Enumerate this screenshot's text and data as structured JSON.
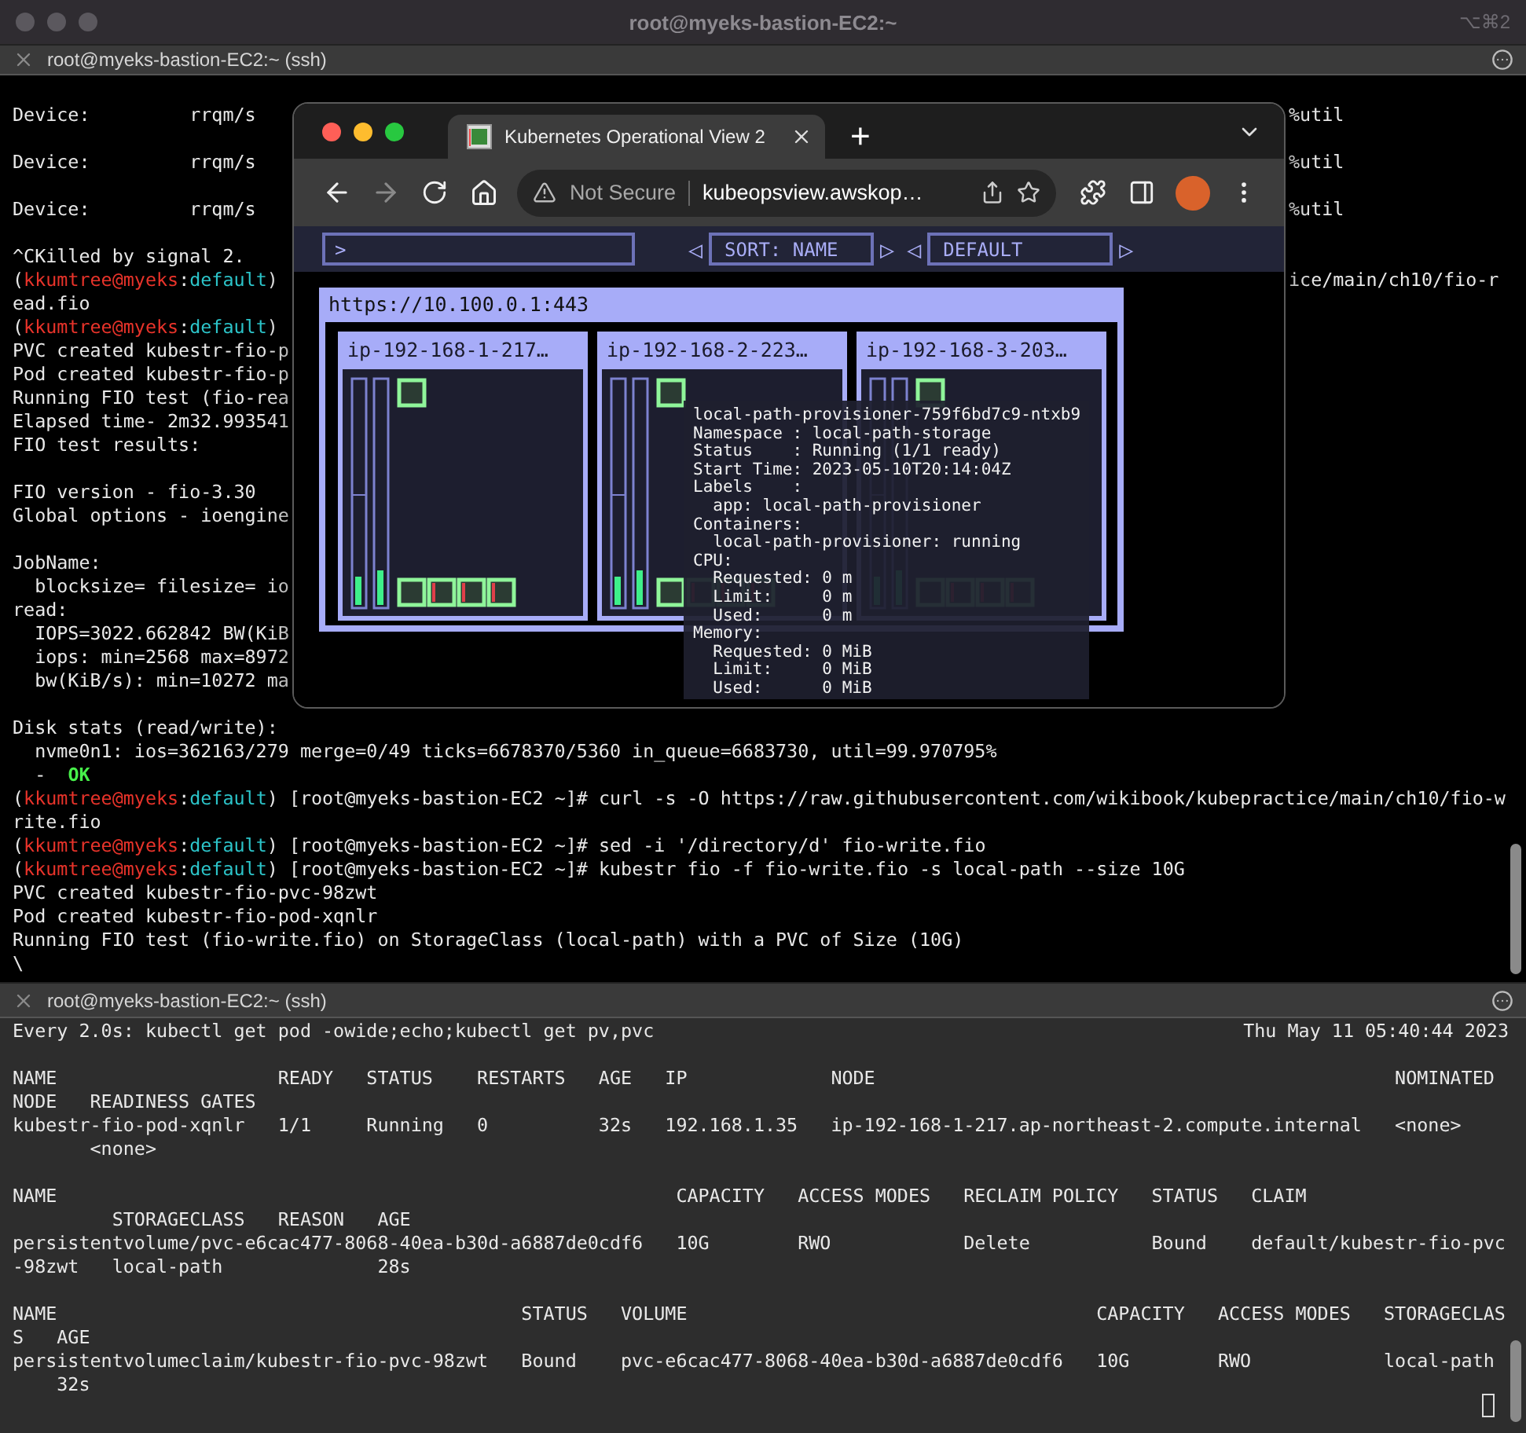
{
  "window": {
    "title": "root@myeks-bastion-EC2:~",
    "shortcut": "⌥⌘2"
  },
  "top_pane": {
    "tab_title": "root@myeks-bastion-EC2:~ (ssh)",
    "lines": [
      {
        "kind": "text",
        "parts": [
          {
            "text": "Device:         rrqm/s",
            "kind": "plain"
          }
        ],
        "right": "%util"
      },
      {
        "kind": "blank"
      },
      {
        "kind": "text",
        "parts": [
          {
            "text": "Device:         rrqm/s",
            "kind": "plain"
          }
        ],
        "right": "%util"
      },
      {
        "kind": "blank"
      },
      {
        "kind": "text",
        "parts": [
          {
            "text": "Device:         rrqm/s",
            "kind": "plain"
          }
        ],
        "right": "%util"
      },
      {
        "kind": "blank"
      },
      {
        "kind": "text",
        "parts": [
          {
            "text": "^CKilled by signal 2.",
            "kind": "plain"
          }
        ]
      },
      {
        "kind": "text",
        "parts": [
          {
            "text": "(",
            "kind": "plain"
          },
          {
            "text": "kkumtree@myeks",
            "kind": "user"
          },
          {
            "text": ":",
            "kind": "plain"
          },
          {
            "text": "default",
            "kind": "ns"
          },
          {
            "text": ")",
            "kind": "plain"
          }
        ],
        "right": "ice/main/ch10/fio-r"
      },
      {
        "kind": "text",
        "parts": [
          {
            "text": "ead.fio",
            "kind": "plain"
          }
        ]
      },
      {
        "kind": "text",
        "parts": [
          {
            "text": "(",
            "kind": "plain"
          },
          {
            "text": "kkumtree@myeks",
            "kind": "user"
          },
          {
            "text": ":",
            "kind": "plain"
          },
          {
            "text": "default",
            "kind": "ns"
          },
          {
            "text": ")",
            "kind": "plain"
          }
        ]
      },
      {
        "kind": "text",
        "parts": [
          {
            "text": "PVC created kubestr-fio-p",
            "kind": "plain"
          }
        ]
      },
      {
        "kind": "text",
        "parts": [
          {
            "text": "Pod created kubestr-fio-p",
            "kind": "plain"
          }
        ]
      },
      {
        "kind": "text",
        "parts": [
          {
            "text": "Running FIO test (fio-rea",
            "kind": "plain"
          }
        ]
      },
      {
        "kind": "text",
        "parts": [
          {
            "text": "Elapsed time- 2m32.993541",
            "kind": "plain"
          }
        ]
      },
      {
        "kind": "text",
        "parts": [
          {
            "text": "FIO test results:",
            "kind": "plain"
          }
        ]
      },
      {
        "kind": "blank"
      },
      {
        "kind": "text",
        "parts": [
          {
            "text": "FIO version - fio-3.30",
            "kind": "plain"
          }
        ]
      },
      {
        "kind": "text",
        "parts": [
          {
            "text": "Global options - ioengine",
            "kind": "plain"
          }
        ]
      },
      {
        "kind": "blank"
      },
      {
        "kind": "text",
        "parts": [
          {
            "text": "JobName:",
            "kind": "plain"
          }
        ]
      },
      {
        "kind": "text",
        "parts": [
          {
            "text": "  blocksize= filesize= io",
            "kind": "plain"
          }
        ]
      },
      {
        "kind": "text",
        "parts": [
          {
            "text": "read:",
            "kind": "plain"
          }
        ]
      },
      {
        "kind": "text",
        "parts": [
          {
            "text": "  IOPS=3022.662842 BW(KiB",
            "kind": "plain"
          }
        ]
      },
      {
        "kind": "text",
        "parts": [
          {
            "text": "  iops: min=2568 max=8972",
            "kind": "plain"
          }
        ]
      },
      {
        "kind": "text",
        "parts": [
          {
            "text": "  bw(KiB/s): min=10272 ma",
            "kind": "plain"
          }
        ]
      },
      {
        "kind": "blank"
      },
      {
        "kind": "text",
        "parts": [
          {
            "text": "Disk stats (read/write):",
            "kind": "plain"
          }
        ]
      },
      {
        "kind": "text",
        "parts": [
          {
            "text": "  nvme0n1: ios=362163/279 merge=0/49 ticks=6678370/5360 in_queue=6683730, util=99.970795%",
            "kind": "plain"
          }
        ]
      },
      {
        "kind": "text",
        "parts": [
          {
            "text": "  -  ",
            "kind": "plain"
          },
          {
            "text": "OK",
            "kind": "ok"
          }
        ]
      },
      {
        "kind": "text",
        "parts": [
          {
            "text": "(",
            "kind": "plain"
          },
          {
            "text": "kkumtree@myeks",
            "kind": "user"
          },
          {
            "text": ":",
            "kind": "plain"
          },
          {
            "text": "default",
            "kind": "ns"
          },
          {
            "text": ") [root@myeks-bastion-EC2 ~]# curl -s -O https://raw.githubusercontent.com/wikibook/kubepractice/main/ch10/fio-w",
            "kind": "plain"
          }
        ]
      },
      {
        "kind": "text",
        "parts": [
          {
            "text": "rite.fio",
            "kind": "plain"
          }
        ]
      },
      {
        "kind": "text",
        "parts": [
          {
            "text": "(",
            "kind": "plain"
          },
          {
            "text": "kkumtree@myeks",
            "kind": "user"
          },
          {
            "text": ":",
            "kind": "plain"
          },
          {
            "text": "default",
            "kind": "ns"
          },
          {
            "text": ") [root@myeks-bastion-EC2 ~]# sed -i '/directory/d' fio-write.fio",
            "kind": "plain"
          }
        ]
      },
      {
        "kind": "text",
        "parts": [
          {
            "text": "(",
            "kind": "plain"
          },
          {
            "text": "kkumtree@myeks",
            "kind": "user"
          },
          {
            "text": ":",
            "kind": "plain"
          },
          {
            "text": "default",
            "kind": "ns"
          },
          {
            "text": ") [root@myeks-bastion-EC2 ~]# kubestr fio -f fio-write.fio -s local-path --size 10G",
            "kind": "plain"
          }
        ]
      },
      {
        "kind": "text",
        "parts": [
          {
            "text": "PVC created kubestr-fio-pvc-98zwt",
            "kind": "plain"
          }
        ]
      },
      {
        "kind": "text",
        "parts": [
          {
            "text": "Pod created kubestr-fio-pod-xqnlr",
            "kind": "plain"
          }
        ]
      },
      {
        "kind": "text",
        "parts": [
          {
            "text": "Running FIO test (fio-write.fio) on StorageClass (local-path) with a PVC of Size (10G)",
            "kind": "plain"
          }
        ]
      },
      {
        "kind": "text",
        "parts": [
          {
            "text": "\\",
            "kind": "plain"
          }
        ]
      }
    ]
  },
  "browser": {
    "tab": {
      "title": "Kubernetes Operational View 2",
      "selected": true
    },
    "new_tab": "+",
    "security": "Not Secure",
    "url": "kubeopsview.awskop…",
    "app": {
      "filter": {
        "value": ">"
      },
      "prev": "◁",
      "next": "▷",
      "sort": "SORT: NAME",
      "theme": "DEFAULT",
      "cluster": {
        "name": "https://10.100.0.1:443",
        "nodes": [
          {
            "name": "ip-192-168-1-217…"
          },
          {
            "name": "ip-192-168-2-223…"
          },
          {
            "name": "ip-192-168-3-203…"
          }
        ]
      },
      "tooltip": [
        "local-path-provisioner-759f6bd7c9-ntxb9",
        "Namespace : local-path-storage",
        "Status    : Running (1/1 ready)",
        "Start Time: 2023-05-10T20:14:04Z",
        "Labels    :",
        "  app: local-path-provisioner",
        "Containers:",
        "  local-path-provisioner: running",
        "CPU:",
        "  Requested: 0 m",
        "  Limit:     0 m",
        "  Used:      0 m",
        "Memory:",
        "  Requested: 0 MiB",
        "  Limit:     0 MiB",
        "  Used:      0 MiB"
      ]
    }
  },
  "bottom_pane": {
    "tab_title": "root@myeks-bastion-EC2:~ (ssh)",
    "command": "Every 2.0s: kubectl get pod -owide;echo;kubectl get pv,pvc",
    "timestamp": "Thu May 11 05:40:44 2023",
    "lines": [
      {
        "kind": "blank"
      },
      {
        "kind": "text",
        "text": "NAME                    READY   STATUS    RESTARTS   AGE   IP             NODE                                               NOMINATED"
      },
      {
        "kind": "text",
        "text": "NODE   READINESS GATES"
      },
      {
        "kind": "text",
        "text": "kubestr-fio-pod-xqnlr   1/1     Running   0          32s   192.168.1.35   ip-192-168-1-217.ap-northeast-2.compute.internal   <none>"
      },
      {
        "kind": "text",
        "text": "       <none>"
      },
      {
        "kind": "blank"
      },
      {
        "kind": "text",
        "text": "NAME                                                        CAPACITY   ACCESS MODES   RECLAIM POLICY   STATUS   CLAIM"
      },
      {
        "kind": "text",
        "text": "         STORAGECLASS   REASON   AGE"
      },
      {
        "kind": "text",
        "text": "persistentvolume/pvc-e6cac477-8068-40ea-b30d-a6887de0cdf6   10G        RWO            Delete           Bound    default/kubestr-fio-pvc"
      },
      {
        "kind": "text",
        "text": "-98zwt   local-path              28s"
      },
      {
        "kind": "blank"
      },
      {
        "kind": "text",
        "text": "NAME                                          STATUS   VOLUME                                     CAPACITY   ACCESS MODES   STORAGECLAS"
      },
      {
        "kind": "text",
        "text": "S   AGE"
      },
      {
        "kind": "text",
        "text": "persistentvolumeclaim/kubestr-fio-pvc-98zwt   Bound    pvc-e6cac477-8068-40ea-b30d-a6887de0cdf6   10G        RWO            local-path"
      },
      {
        "kind": "text",
        "text": "    32s"
      }
    ]
  }
}
